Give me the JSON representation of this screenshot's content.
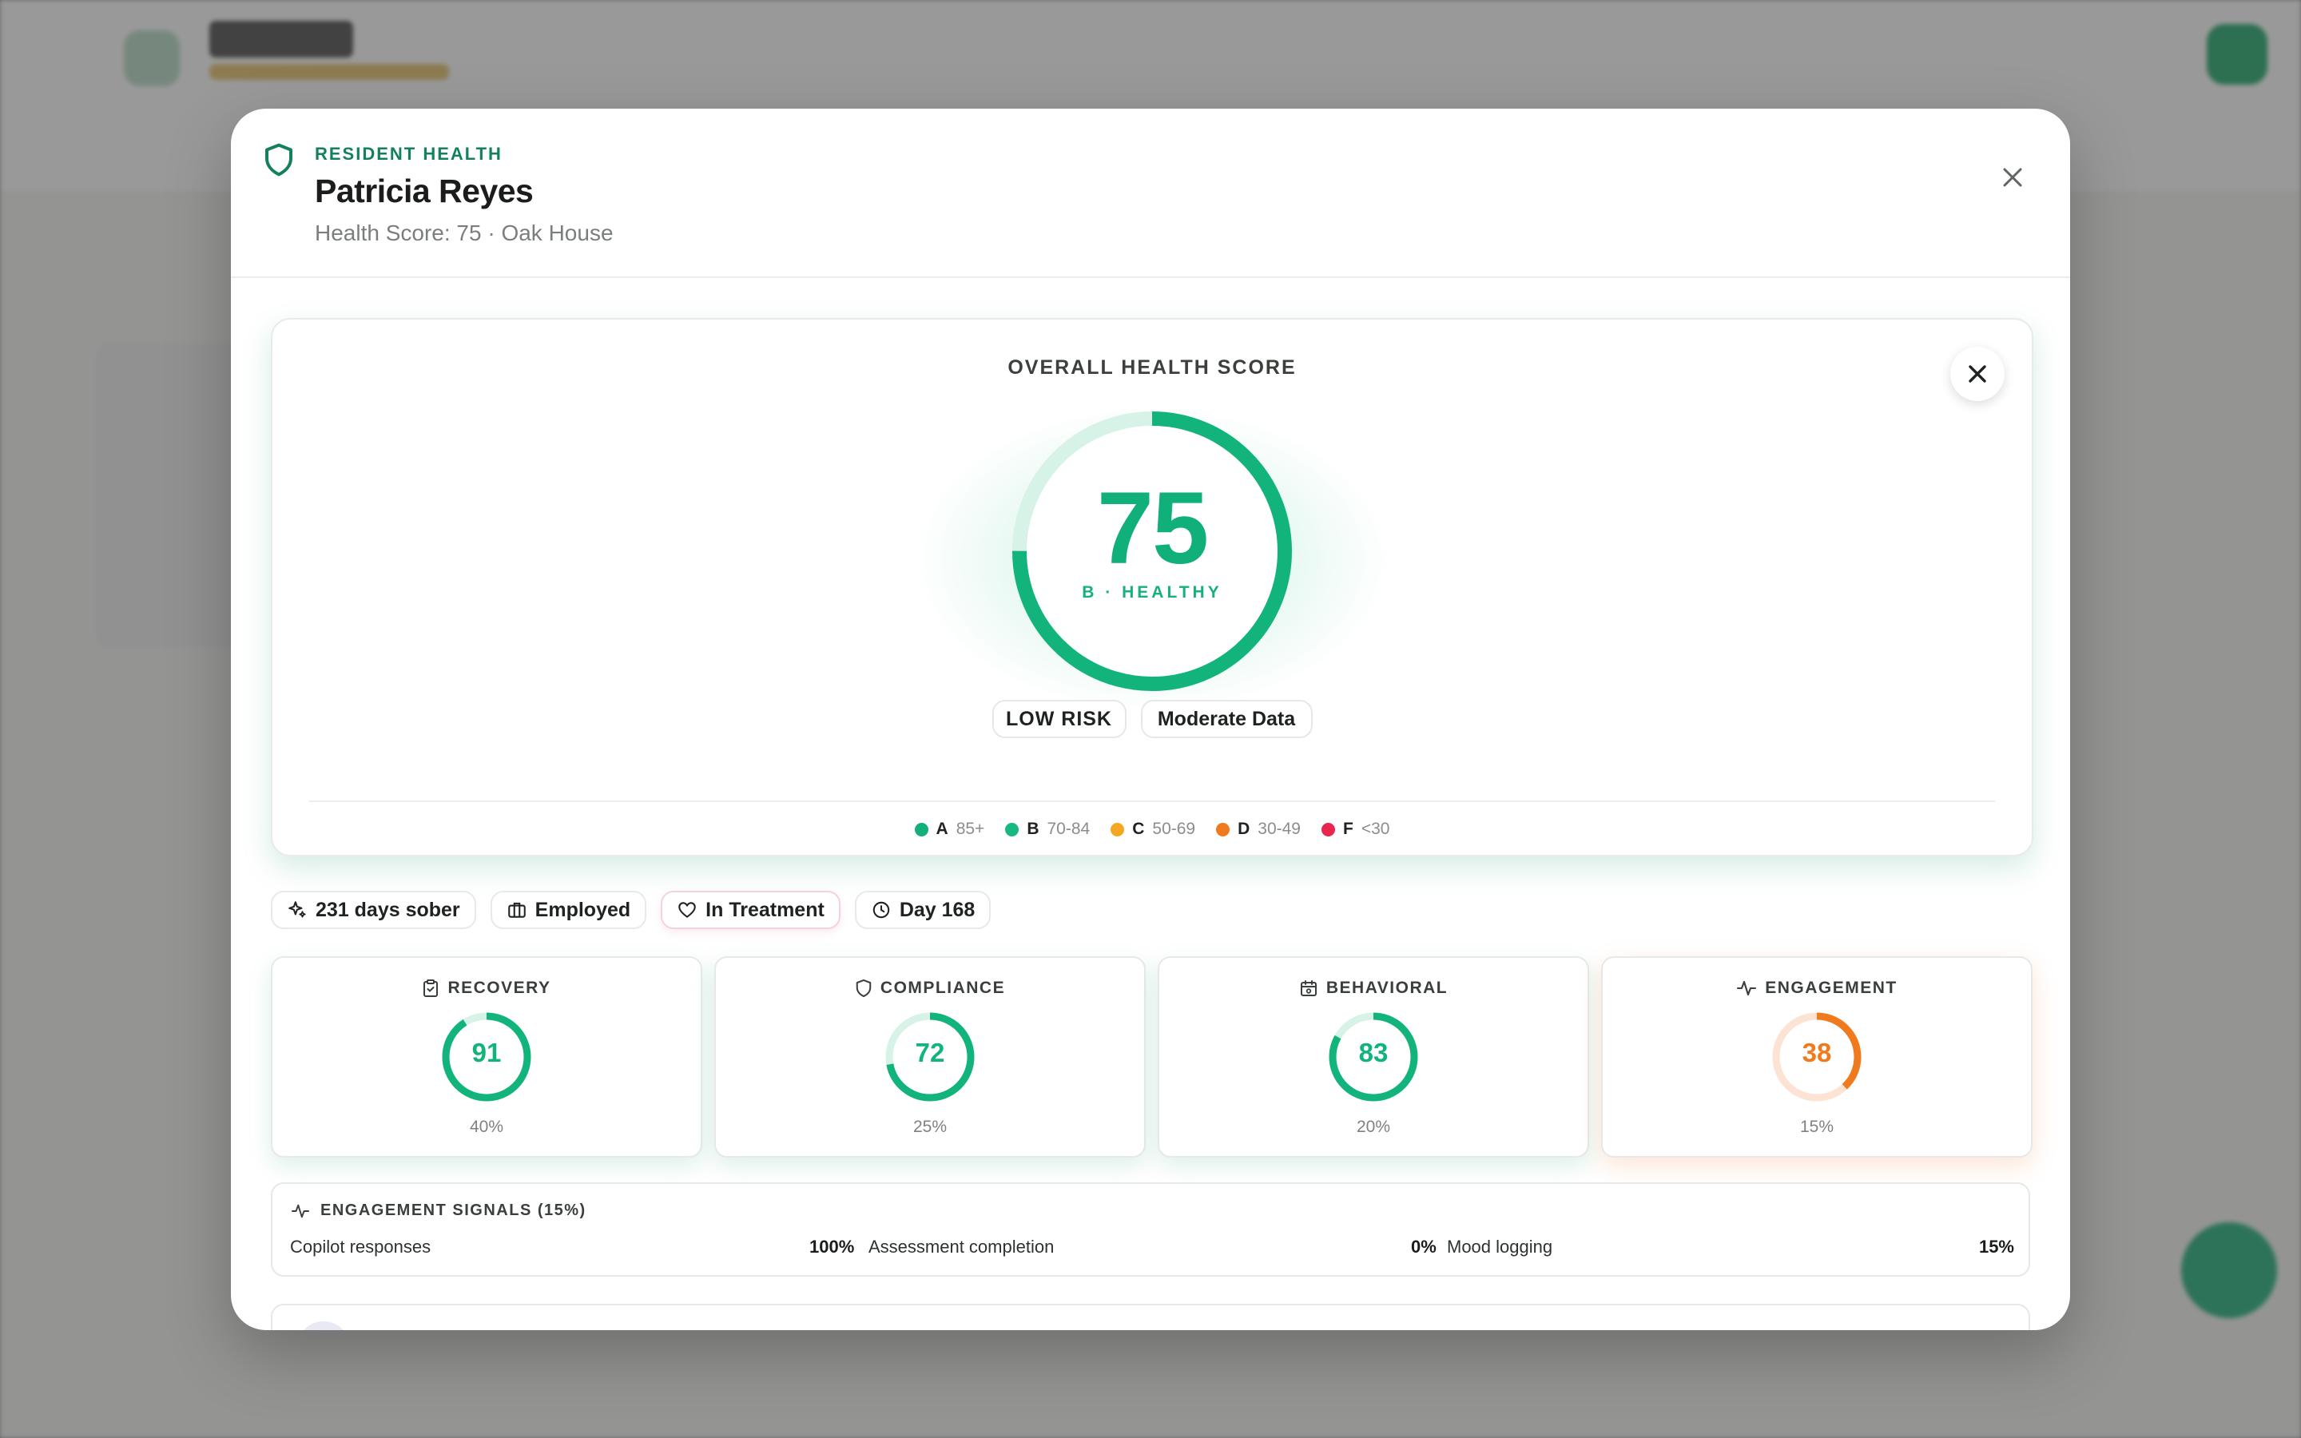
{
  "modal": {
    "eyebrow": "RESIDENT HEALTH",
    "title": "Patricia Reyes",
    "subtitle": "Health Score: 75 · Oak House"
  },
  "overall": {
    "label": "OVERALL HEALTH SCORE",
    "score": 75,
    "score_text": "75",
    "grade_text": "B · HEALTHY",
    "risk_label": "LOW RISK",
    "data_label": "Moderate Data",
    "ring_color": "#13b47c"
  },
  "legend": [
    {
      "grade": "A",
      "range": "85+",
      "color": "#11b07a"
    },
    {
      "grade": "B",
      "range": "70-84",
      "color": "#19b882"
    },
    {
      "grade": "C",
      "range": "50-69",
      "color": "#f5a623"
    },
    {
      "grade": "D",
      "range": "30-49",
      "color": "#f07a1e"
    },
    {
      "grade": "F",
      "range": "<30",
      "color": "#e8264f"
    }
  ],
  "chips": [
    {
      "label": "231 days sober",
      "icon": "sparkle-icon"
    },
    {
      "label": "Employed",
      "icon": "briefcase-icon"
    },
    {
      "label": "In Treatment",
      "icon": "heart-icon"
    },
    {
      "label": "Day 168",
      "icon": "clock-icon"
    }
  ],
  "components": [
    {
      "label": "RECOVERY",
      "icon": "clipboard-check-icon",
      "score": 91,
      "score_text": "91",
      "weight": "40%",
      "color": "#13b47c"
    },
    {
      "label": "COMPLIANCE",
      "icon": "shield-icon",
      "score": 72,
      "score_text": "72",
      "weight": "25%",
      "color": "#13b47c"
    },
    {
      "label": "BEHAVIORAL",
      "icon": "calendar-icon",
      "score": 83,
      "score_text": "83",
      "weight": "20%",
      "color": "#13b47c"
    },
    {
      "label": "ENGAGEMENT",
      "icon": "activity-icon",
      "score": 38,
      "score_text": "38",
      "weight": "15%",
      "color": "#f07a1e"
    }
  ],
  "signals": {
    "title": "ENGAGEMENT SIGNALS (15%)",
    "items": [
      {
        "label": "Copilot responses",
        "value": "100%"
      },
      {
        "label": "Assessment completion",
        "value": "0%"
      },
      {
        "label": "Mood logging",
        "value": "15%"
      }
    ]
  }
}
